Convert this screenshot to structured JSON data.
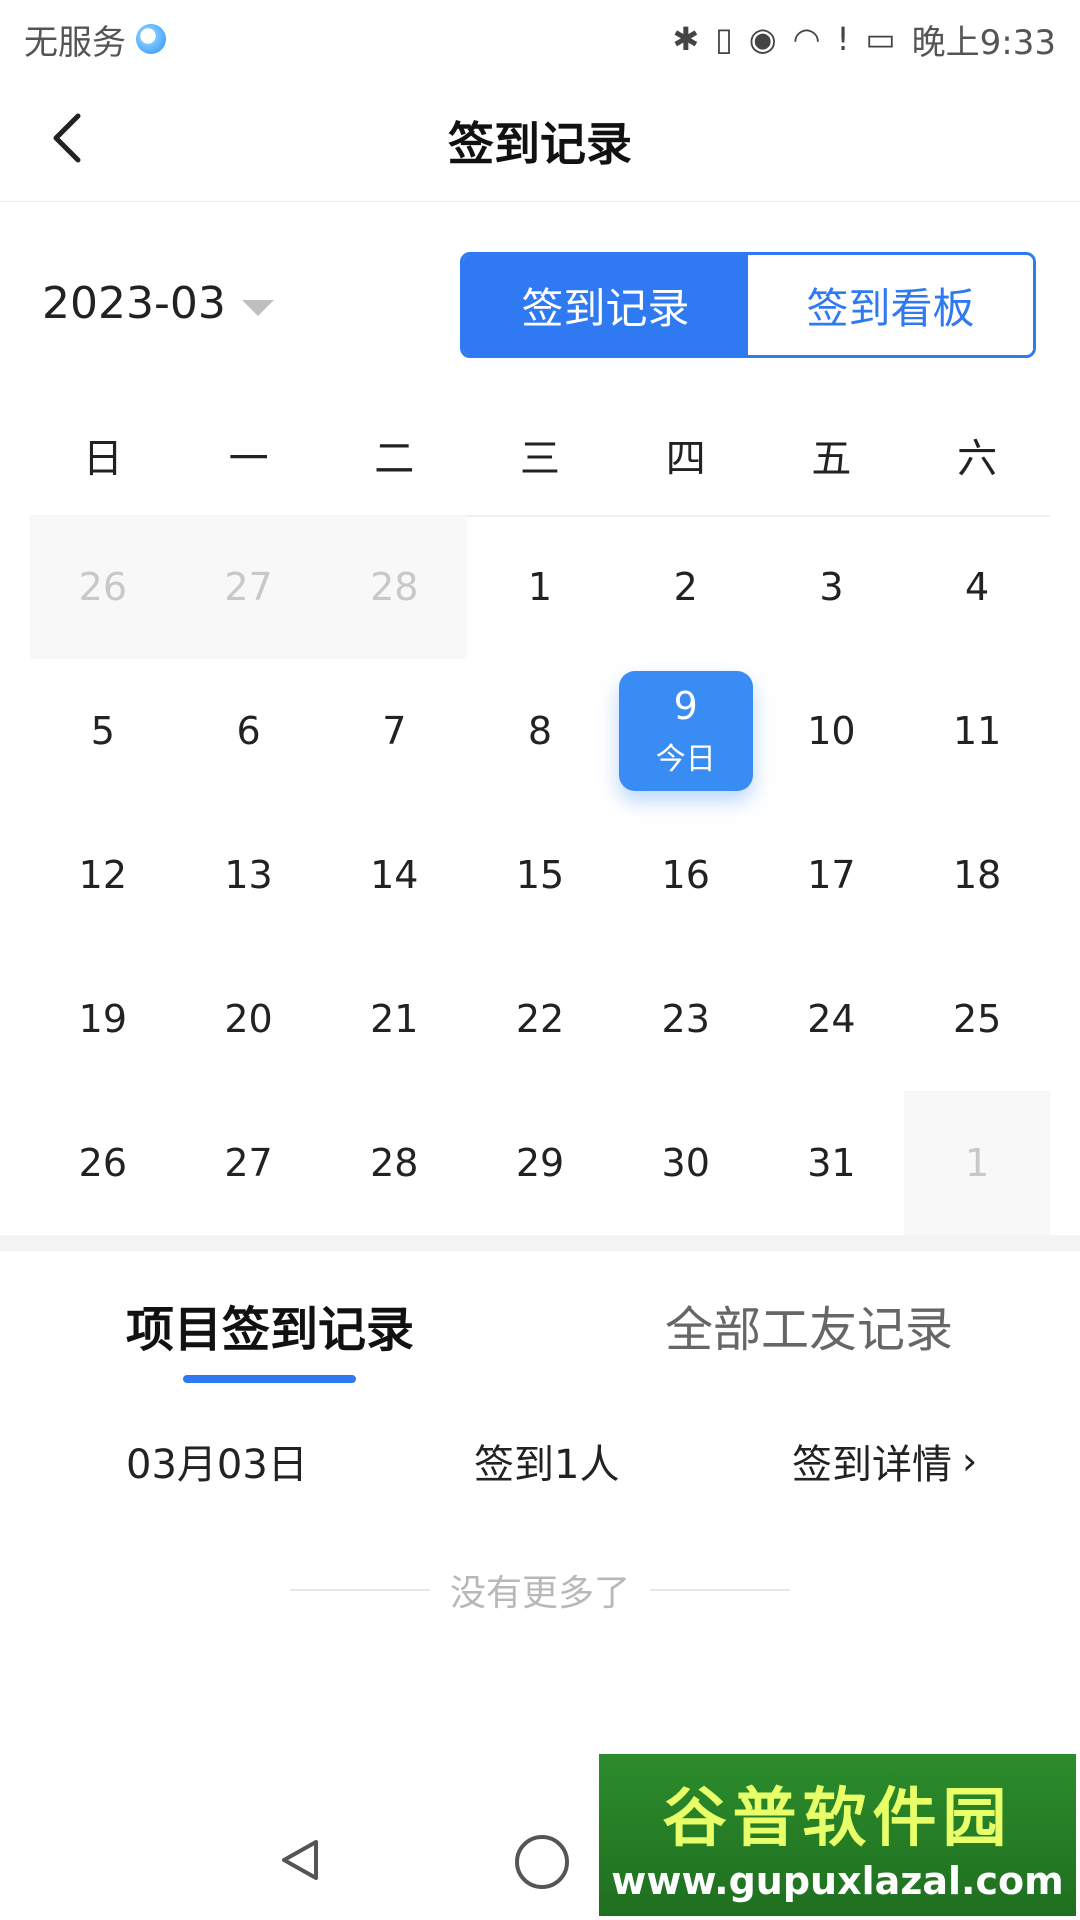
{
  "status": {
    "carrier": "无服务",
    "time": "晚上9:33",
    "icons": [
      "bluetooth-icon",
      "vibrate-icon",
      "eye-icon",
      "wifi-icon",
      "alert-icon",
      "battery-icon"
    ]
  },
  "header": {
    "title": "签到记录",
    "back_icon": "back-icon"
  },
  "controls": {
    "month": "2023-03",
    "segment": [
      {
        "label": "签到记录",
        "active": true
      },
      {
        "label": "签到看板",
        "active": false
      }
    ]
  },
  "calendar": {
    "weekdays": [
      "日",
      "一",
      "二",
      "三",
      "四",
      "五",
      "六"
    ],
    "weeks": [
      [
        "26",
        "27",
        "28",
        "1",
        "2",
        "3",
        "4"
      ],
      [
        "5",
        "6",
        "7",
        "8",
        "9",
        "10",
        "11"
      ],
      [
        "12",
        "13",
        "14",
        "15",
        "16",
        "17",
        "18"
      ],
      [
        "19",
        "20",
        "21",
        "22",
        "23",
        "24",
        "25"
      ],
      [
        "26",
        "27",
        "28",
        "29",
        "30",
        "31",
        "1"
      ]
    ],
    "today_label": "今日"
  },
  "tabs": {
    "project": "项目签到记录",
    "all": "全部工友记录"
  },
  "record": {
    "date": "03月03日",
    "count": "签到1人",
    "detail": "签到详情",
    "chevron": "›"
  },
  "no_more": "没有更多了",
  "watermark": {
    "title": "谷普软件园",
    "url": "www.gupuxlazal.com"
  },
  "colors": {
    "accent": "#2f7af3",
    "today": "#3a8cf5"
  }
}
